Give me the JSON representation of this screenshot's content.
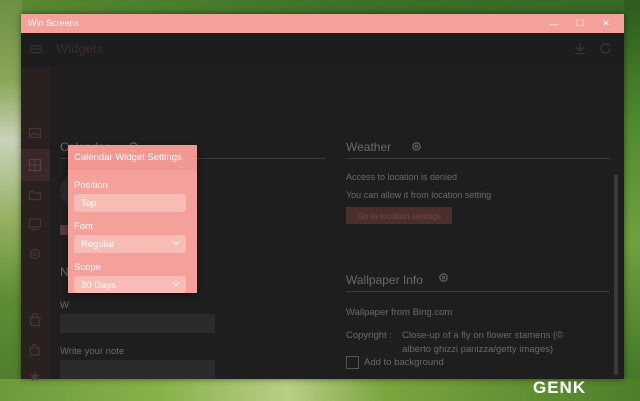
{
  "window": {
    "title": "Win Screens",
    "controls": {
      "minimize": "—",
      "maximize": "☐",
      "close": "✕"
    }
  },
  "header": {
    "page_title": "Widgets"
  },
  "sidebar": {
    "icons": [
      "image-icon",
      "widgets-icon",
      "folder-icon",
      "monitor-icon",
      "settings-icon",
      "store-icon",
      "puzzle-icon",
      "star-icon",
      "feedback-icon"
    ]
  },
  "calendar_section": {
    "title": "Calendar"
  },
  "notes_section": {
    "title_fragment": "N",
    "label_fragment": "W",
    "write_note_label": "Write your note"
  },
  "weather_section": {
    "title": "Weather",
    "line1": "Access to location is denied",
    "line2": "You can allow it from location setting",
    "button_label": "Go to location settings"
  },
  "wallpaper_section": {
    "title": "Wallpaper Info",
    "source": "Wallpaper from Bing.com",
    "copyright_label": "Copyright :",
    "copyright_line1": "Close-up of a fly on flower stamens (©",
    "copyright_line2": "alberto ghizzi panizza/getty images)",
    "add_to_background": "Add to background"
  },
  "popup": {
    "title": "Calendar Widget Settings",
    "position_label": "Position",
    "position_value": "Top",
    "font_label": "Font",
    "font_value": "Regular",
    "scope_label": "Scope",
    "scope_value": "30 Days",
    "chevron": "⌄"
  },
  "watermark": "GENK",
  "colors": {
    "accent": "#f3a19a",
    "window_bg": "#1e1e1e",
    "muted_text": "#6a6a6a"
  }
}
